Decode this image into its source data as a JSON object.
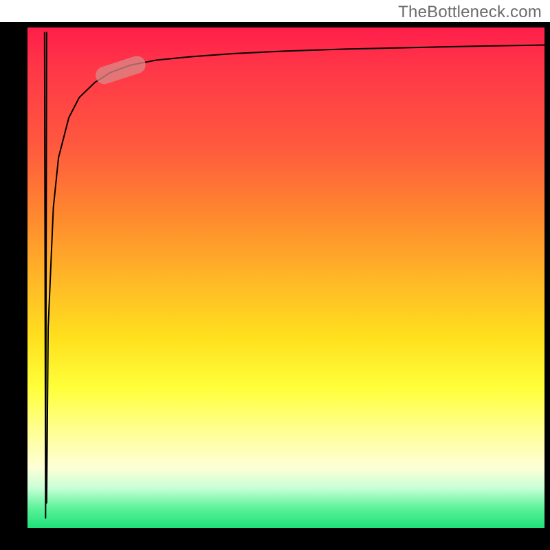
{
  "watermark": "TheBottleneck.com",
  "chart_data": {
    "type": "line",
    "title": "",
    "xlabel": "",
    "ylabel": "",
    "xlim": [
      0,
      100
    ],
    "ylim": [
      0,
      100
    ],
    "grid": false,
    "legend": false,
    "background_gradient": {
      "direction": "vertical",
      "stops": [
        {
          "pos": 0.0,
          "color": "#ff1e4a"
        },
        {
          "pos": 0.3,
          "color": "#ff7a30"
        },
        {
          "pos": 0.55,
          "color": "#ffd420"
        },
        {
          "pos": 0.75,
          "color": "#ffff40"
        },
        {
          "pos": 0.9,
          "color": "#e8ffd0"
        },
        {
          "pos": 1.0,
          "color": "#1fe07a"
        }
      ]
    },
    "series": [
      {
        "name": "spike",
        "stroke": "#000000",
        "width": 2,
        "x": [
          3.3,
          3.5,
          3.7
        ],
        "y": [
          99,
          2,
          99
        ]
      },
      {
        "name": "curve",
        "stroke": "#000000",
        "width": 2,
        "x": [
          3.7,
          4,
          5,
          6,
          8,
          10,
          13,
          16,
          20,
          25,
          32,
          40,
          50,
          62,
          75,
          88,
          100
        ],
        "y": [
          5,
          40,
          64,
          74,
          82,
          86,
          89,
          91,
          92.5,
          93.5,
          94.2,
          94.8,
          95.3,
          95.7,
          96.0,
          96.3,
          96.5
        ]
      }
    ],
    "marker": {
      "name": "highlight-pill",
      "color": "#d98a87",
      "opacity": 0.75,
      "center_x": 18,
      "center_y": 91.5,
      "length": 10,
      "thickness": 3.5,
      "angle_deg": -18
    }
  }
}
